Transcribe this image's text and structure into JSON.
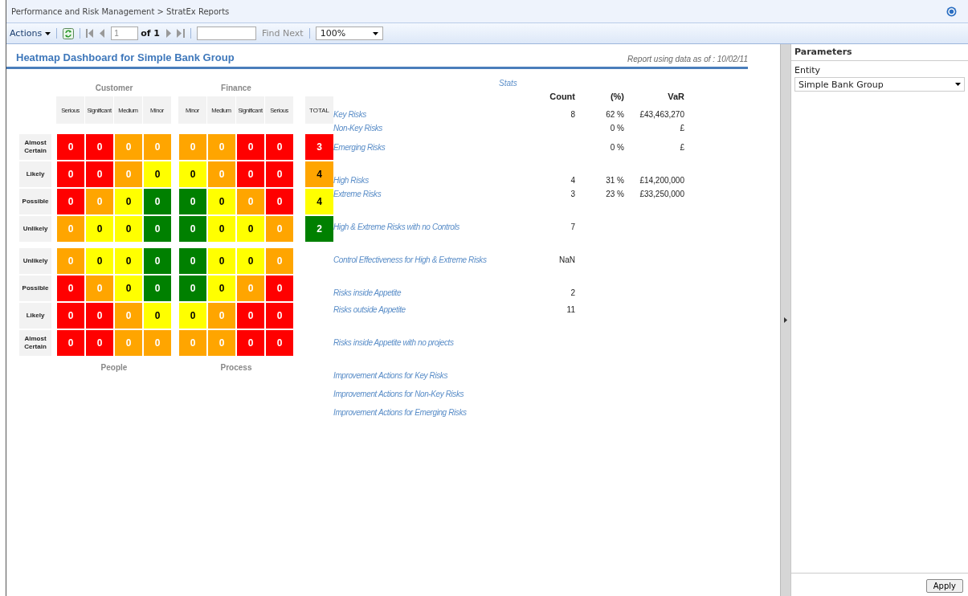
{
  "breadcrumb": "Performance and Risk Management > StratEx Reports",
  "toolbar": {
    "actions": "Actions",
    "page": "1",
    "page_of": "of 1",
    "find_next": {
      "label": "Find Next",
      "disabled": true
    },
    "zoom": "100%"
  },
  "report": {
    "title": "Heatmap Dashboard for Simple Bank Group",
    "data_note": "Report using data as of : 10/02/11",
    "heatmap": {
      "top_block": {
        "row_labels": [
          "Almost Certain",
          "Likely",
          "Possible",
          "Unlikely"
        ],
        "quadrants": [
          {
            "title": "Customer",
            "columns": [
              "Serious",
              "Significant",
              "Medium",
              "Minor"
            ],
            "rows": [
              [
                {
                  "value": "0",
                  "color": "#ff0000"
                },
                {
                  "value": "0",
                  "color": "#ff0000"
                },
                {
                  "value": "0",
                  "color": "#ffa500"
                },
                {
                  "value": "0",
                  "color": "#ffa500"
                }
              ],
              [
                {
                  "value": "0",
                  "color": "#ff0000"
                },
                {
                  "value": "0",
                  "color": "#ff0000"
                },
                {
                  "value": "0",
                  "color": "#ffa500"
                },
                {
                  "value": "0",
                  "color": "#ffff00"
                }
              ],
              [
                {
                  "value": "0",
                  "color": "#ff0000"
                },
                {
                  "value": "0",
                  "color": "#ffa500"
                },
                {
                  "value": "0",
                  "color": "#ffff00"
                },
                {
                  "value": "0",
                  "color": "#008000"
                }
              ],
              [
                {
                  "value": "0",
                  "color": "#ffa500"
                },
                {
                  "value": "0",
                  "color": "#ffff00"
                },
                {
                  "value": "0",
                  "color": "#ffff00"
                },
                {
                  "value": "0",
                  "color": "#008000"
                }
              ]
            ]
          },
          {
            "title": "Finance",
            "columns": [
              "Minor",
              "Medium",
              "Significant",
              "Serious"
            ],
            "rows": [
              [
                {
                  "value": "0",
                  "color": "#ffa500"
                },
                {
                  "value": "0",
                  "color": "#ffa500"
                },
                {
                  "value": "0",
                  "color": "#ff0000"
                },
                {
                  "value": "0",
                  "color": "#ff0000"
                }
              ],
              [
                {
                  "value": "0",
                  "color": "#ffff00"
                },
                {
                  "value": "0",
                  "color": "#ffa500"
                },
                {
                  "value": "0",
                  "color": "#ff0000"
                },
                {
                  "value": "0",
                  "color": "#ff0000"
                }
              ],
              [
                {
                  "value": "0",
                  "color": "#008000"
                },
                {
                  "value": "0",
                  "color": "#ffff00"
                },
                {
                  "value": "0",
                  "color": "#ffa500"
                },
                {
                  "value": "0",
                  "color": "#ff0000"
                }
              ],
              [
                {
                  "value": "0",
                  "color": "#008000"
                },
                {
                  "value": "0",
                  "color": "#ffff00"
                },
                {
                  "value": "0",
                  "color": "#ffff00"
                },
                {
                  "value": "0",
                  "color": "#ffa500"
                }
              ]
            ]
          }
        ]
      },
      "bottom_block": {
        "row_labels": [
          "Unlikely",
          "Possible",
          "Likely",
          "Almost Certain"
        ],
        "quadrants": [
          {
            "title": "People",
            "rows": [
              [
                {
                  "value": "0",
                  "color": "#ffa500"
                },
                {
                  "value": "0",
                  "color": "#ffff00"
                },
                {
                  "value": "0",
                  "color": "#ffff00"
                },
                {
                  "value": "0",
                  "color": "#008000"
                }
              ],
              [
                {
                  "value": "0",
                  "color": "#ff0000"
                },
                {
                  "value": "0",
                  "color": "#ffa500"
                },
                {
                  "value": "0",
                  "color": "#ffff00"
                },
                {
                  "value": "0",
                  "color": "#008000"
                }
              ],
              [
                {
                  "value": "0",
                  "color": "#ff0000"
                },
                {
                  "value": "0",
                  "color": "#ff0000"
                },
                {
                  "value": "0",
                  "color": "#ffa500"
                },
                {
                  "value": "0",
                  "color": "#ffff00"
                }
              ],
              [
                {
                  "value": "0",
                  "color": "#ff0000"
                },
                {
                  "value": "0",
                  "color": "#ff0000"
                },
                {
                  "value": "0",
                  "color": "#ffa500"
                },
                {
                  "value": "0",
                  "color": "#ffa500"
                }
              ]
            ]
          },
          {
            "title": "Process",
            "rows": [
              [
                {
                  "value": "0",
                  "color": "#008000"
                },
                {
                  "value": "0",
                  "color": "#ffff00"
                },
                {
                  "value": "0",
                  "color": "#ffff00"
                },
                {
                  "value": "0",
                  "color": "#ffa500"
                }
              ],
              [
                {
                  "value": "0",
                  "color": "#008000"
                },
                {
                  "value": "0",
                  "color": "#ffff00"
                },
                {
                  "value": "0",
                  "color": "#ffa500"
                },
                {
                  "value": "0",
                  "color": "#ff0000"
                }
              ],
              [
                {
                  "value": "0",
                  "color": "#ffff00"
                },
                {
                  "value": "0",
                  "color": "#ffa500"
                },
                {
                  "value": "0",
                  "color": "#ff0000"
                },
                {
                  "value": "0",
                  "color": "#ff0000"
                }
              ],
              [
                {
                  "value": "0",
                  "color": "#ffa500"
                },
                {
                  "value": "0",
                  "color": "#ffa500"
                },
                {
                  "value": "0",
                  "color": "#ff0000"
                },
                {
                  "value": "0",
                  "color": "#ff0000"
                }
              ]
            ]
          }
        ]
      },
      "total": {
        "label": "TOTAL",
        "cells": [
          {
            "value": "3",
            "color": "#ff0000"
          },
          {
            "value": "4",
            "color": "#ffa500"
          },
          {
            "value": "4",
            "color": "#ffff00"
          },
          {
            "value": "2",
            "color": "#008000"
          }
        ]
      }
    },
    "stats": {
      "title": "Stats",
      "columns": [
        "Count",
        "(%)",
        "VaR"
      ],
      "groups": [
        [
          {
            "label": "Key Risks",
            "count": "8",
            "percent": "62 %",
            "var": "£43,463,270"
          },
          {
            "label": "Non-Key Risks",
            "percent": "0 %",
            "var": "£"
          }
        ],
        [
          {
            "label": "Emerging Risks",
            "percent": "0 %",
            "var": "£"
          }
        ],
        [
          {
            "label": "High Risks",
            "count": "4",
            "percent": "31 %",
            "var": "£14,200,000"
          },
          {
            "label": "Extreme Risks",
            "count": "3",
            "percent": "23 %",
            "var": "£33,250,000"
          }
        ],
        [
          {
            "label": "High & Extreme Risks with no Controls",
            "count": "7"
          }
        ],
        [
          {
            "label": "Control Effectiveness for High & Extreme Risks",
            "count": "NaN"
          }
        ],
        [
          {
            "label": "Risks inside Appetite",
            "count": "2"
          },
          {
            "label": "Risks outside Appetite",
            "count": "11"
          }
        ],
        [
          {
            "label": "Risks inside Appetite with no projects"
          }
        ],
        [
          {
            "label": "Improvement Actions for Key Risks"
          },
          {
            "label": "Improvement Actions for Non-Key Risks"
          },
          {
            "label": "Improvement Actions for Emerging Risks"
          }
        ]
      ]
    }
  },
  "parameters": {
    "title": "Parameters",
    "fields": [
      {
        "label": "Entity",
        "value": "Simple Bank Group"
      }
    ],
    "apply": "Apply"
  }
}
